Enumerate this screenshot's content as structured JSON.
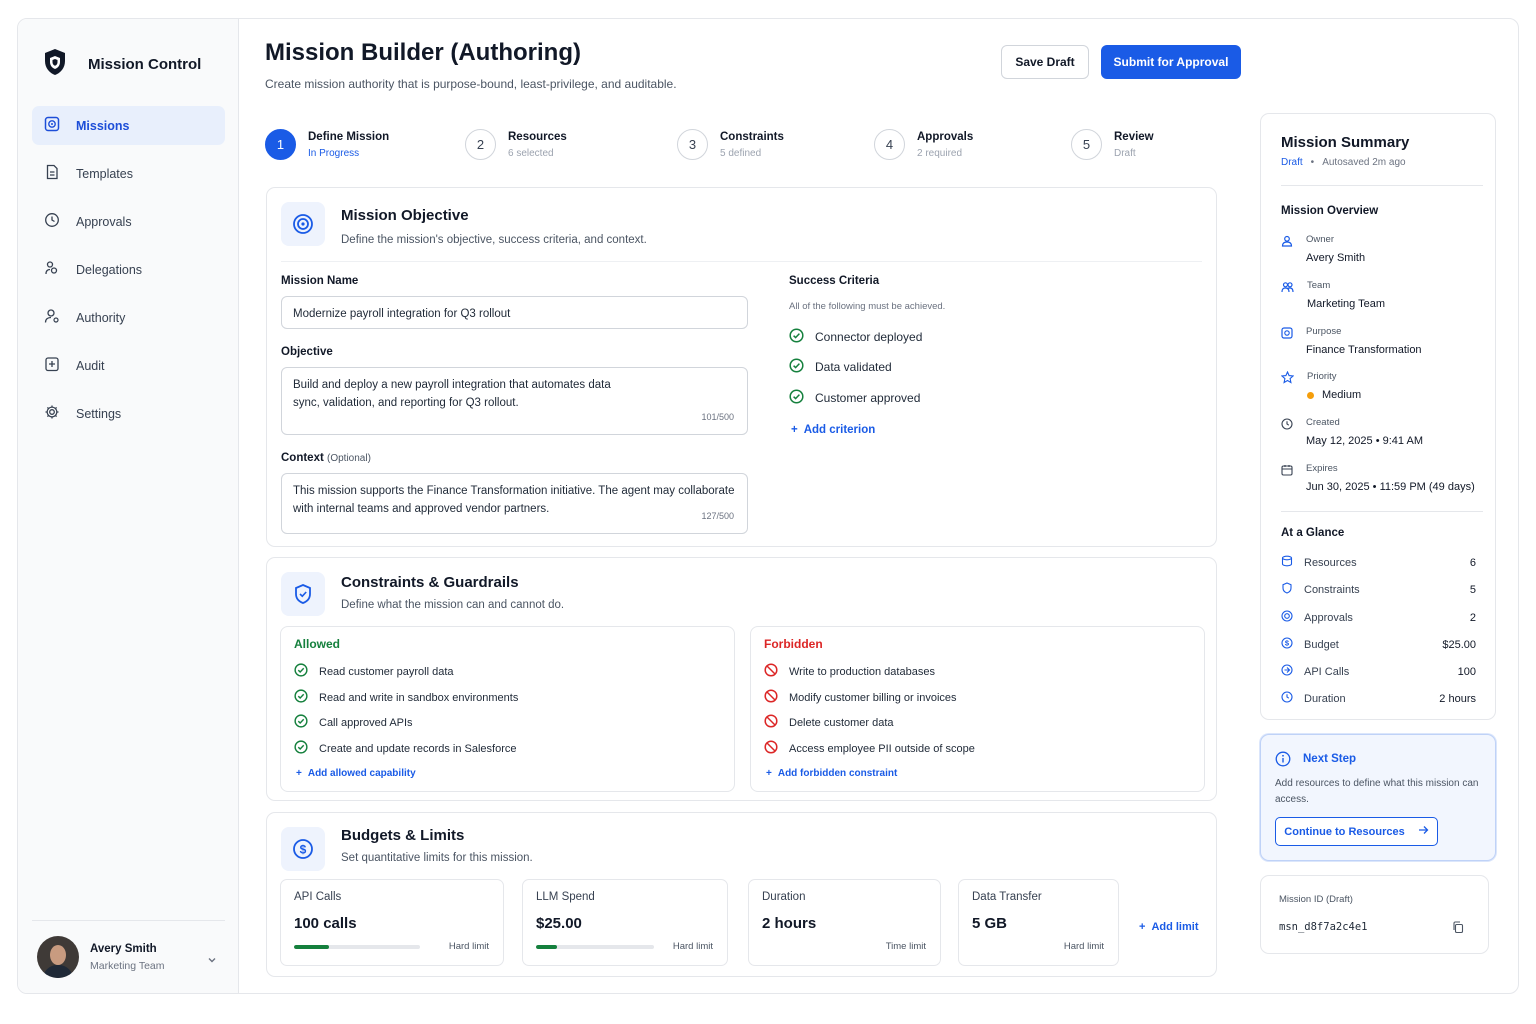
{
  "app": {
    "title": "Mission Control"
  },
  "sidebar": {
    "items": [
      {
        "label": "Missions",
        "icon": "target-icon",
        "active": true
      },
      {
        "label": "Templates",
        "icon": "document-icon"
      },
      {
        "label": "Approvals",
        "icon": "clock-check-icon"
      },
      {
        "label": "Delegations",
        "icon": "delegation-icon"
      },
      {
        "label": "Authority",
        "icon": "user-key-icon"
      },
      {
        "label": "Audit",
        "icon": "audit-icon"
      },
      {
        "label": "Settings",
        "icon": "gear-icon"
      }
    ],
    "user": {
      "name": "Avery Smith",
      "team": "Marketing Team"
    }
  },
  "header": {
    "title": "Mission Builder (Authoring)",
    "subtitle": "Create mission authority that is purpose-bound, least-privilege, and auditable.",
    "save_label": "Save Draft",
    "submit_label": "Submit for Approval"
  },
  "steps": [
    {
      "num": "1",
      "label": "Define Mission",
      "sub": "In Progress",
      "active": true
    },
    {
      "num": "2",
      "label": "Resources",
      "sub": "6 selected"
    },
    {
      "num": "3",
      "label": "Constraints",
      "sub": "5 defined"
    },
    {
      "num": "4",
      "label": "Approvals",
      "sub": "2 required"
    },
    {
      "num": "5",
      "label": "Review",
      "sub": "Draft"
    }
  ],
  "objective": {
    "title": "Mission Objective",
    "subtitle": "Define the mission's objective, success criteria, and context.",
    "name_label": "Mission Name",
    "name_value": "Modernize payroll integration for Q3 rollout",
    "objective_label": "Objective",
    "objective_value": "Build and deploy a new payroll integration that automates data sync, validation, and reporting for Q3 rollout.",
    "objective_count": "101/500",
    "context_label": "Context",
    "context_optional": "(Optional)",
    "context_value": "This mission supports the Finance Transformation initiative. The agent may collaborate with internal teams and approved vendor partners.",
    "context_count": "127/500",
    "criteria_label": "Success Criteria",
    "criteria_hint": "All of the following must be achieved.",
    "criteria": [
      "Connector deployed",
      "Data validated",
      "Customer approved"
    ],
    "add_criterion": "Add criterion"
  },
  "constraints": {
    "title": "Constraints & Guardrails",
    "subtitle": "Define what the mission can and cannot do.",
    "allowed_label": "Allowed",
    "allowed": [
      "Read customer payroll data",
      "Read and write in sandbox environments",
      "Call approved APIs",
      "Create and update records in Salesforce"
    ],
    "add_allowed": "Add allowed capability",
    "forbidden_label": "Forbidden",
    "forbidden": [
      "Write to production databases",
      "Modify customer billing or invoices",
      "Delete customer data",
      "Access employee PII outside of scope"
    ],
    "add_forbidden": "Add forbidden constraint"
  },
  "budgets": {
    "title": "Budgets & Limits",
    "subtitle": "Set quantitative limits for this mission.",
    "limits": [
      {
        "label": "API Calls",
        "value": "100 calls",
        "note": "Hard limit",
        "progress": 0.28
      },
      {
        "label": "LLM Spend",
        "value": "$25.00",
        "note": "Hard limit",
        "progress": 0.18
      },
      {
        "label": "Duration",
        "value": "2 hours",
        "note": "Time limit"
      },
      {
        "label": "Data Transfer",
        "value": "5 GB",
        "note": "Hard limit"
      }
    ],
    "add_limit": "Add limit"
  },
  "summary": {
    "title": "Mission Summary",
    "status": "Draft",
    "autosave": "Autosaved 2m ago",
    "overview_title": "Mission Overview",
    "overview": [
      {
        "label": "Owner",
        "value": "Avery Smith",
        "icon": "user-icon"
      },
      {
        "label": "Team",
        "value": "Marketing Team",
        "icon": "team-icon"
      },
      {
        "label": "Purpose",
        "value": "Finance Transformation",
        "icon": "target-icon"
      },
      {
        "label": "Priority",
        "value": "Medium",
        "icon": "star-icon"
      },
      {
        "label": "Created",
        "value": "May 12, 2025 • 9:41 AM",
        "icon": "clock-icon"
      },
      {
        "label": "Expires",
        "value": "Jun 30, 2025 • 11:59 PM (49 days)",
        "icon": "calendar-icon"
      }
    ],
    "glance_title": "At a Glance",
    "glance": [
      {
        "label": "Resources",
        "value": "6",
        "icon": "database-icon"
      },
      {
        "label": "Constraints",
        "value": "5",
        "icon": "shield-icon"
      },
      {
        "label": "Approvals",
        "value": "2",
        "icon": "target-icon"
      },
      {
        "label": "Budget",
        "value": "$25.00",
        "icon": "dollar-icon"
      },
      {
        "label": "API Calls",
        "value": "100",
        "icon": "api-icon"
      },
      {
        "label": "Duration",
        "value": "2 hours",
        "icon": "clock-icon"
      }
    ]
  },
  "next_step": {
    "title": "Next Step",
    "text": "Add resources to define what this mission can access.",
    "button": "Continue to Resources"
  },
  "mission_id": {
    "label": "Mission ID (Draft)",
    "value": "msn_d8f7a2c4e1"
  },
  "colors": {
    "accent": "#1a5be6",
    "allowed": "#15803d",
    "forbidden": "#dc2626",
    "priority_medium": "#f59e0b"
  }
}
